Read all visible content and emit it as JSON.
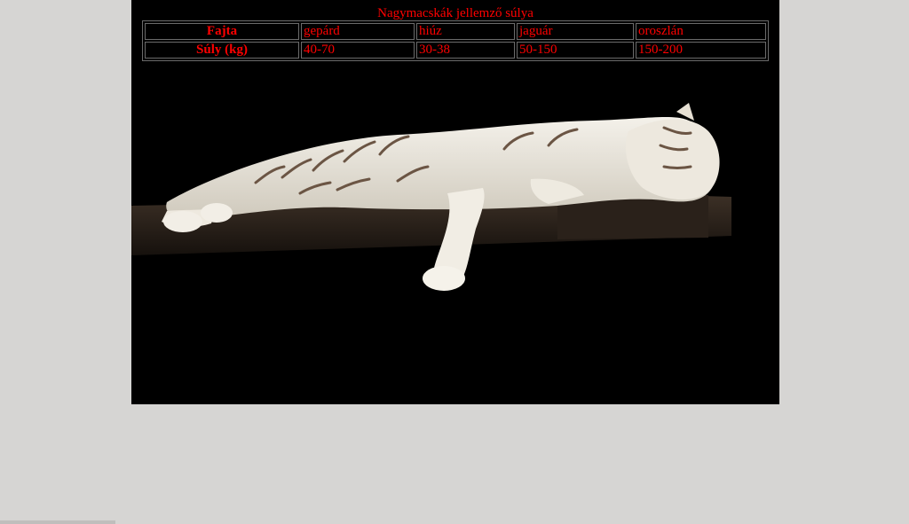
{
  "caption": "Nagymacskák jellemző súlya",
  "table": {
    "header_row_label": "Fajta",
    "species": [
      "gepárd",
      "hiúz",
      "jaguár",
      "oroszlán"
    ],
    "value_row_label": "Súly (kg)",
    "weights": [
      "40-70",
      "30-38",
      "50-150",
      "150-200"
    ]
  },
  "image": {
    "subject": "white-tiger-sleeping-on-log"
  },
  "colors": {
    "page_background": "#d6d5d3",
    "panel_background": "#000000",
    "text": "#ff0000",
    "table_border": "#6b6b6b"
  }
}
